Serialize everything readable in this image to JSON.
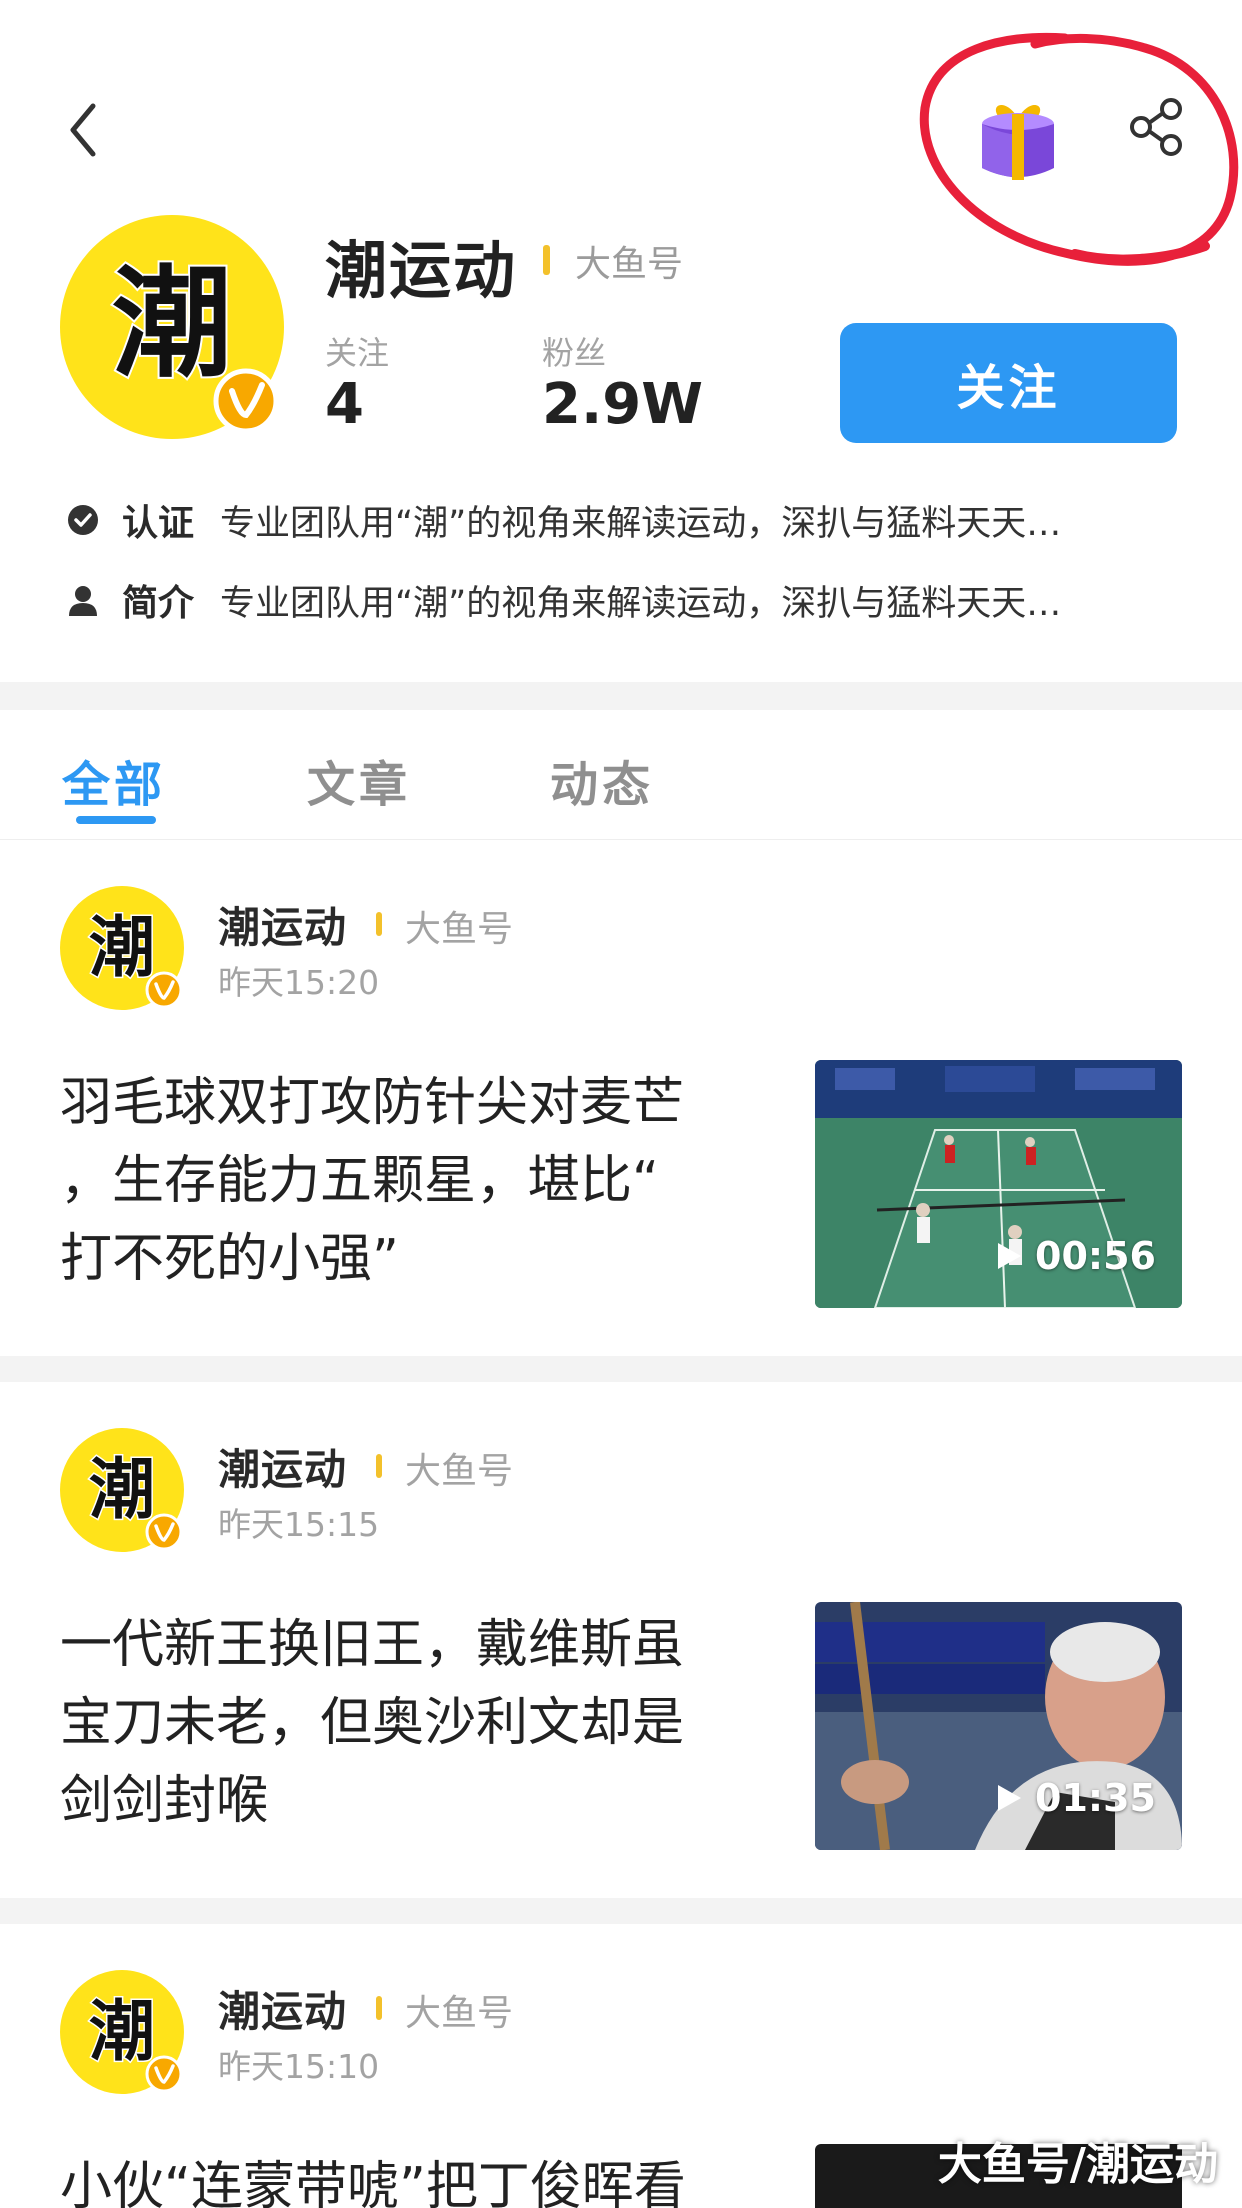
{
  "header": {
    "back_icon": "chevron-left-icon",
    "gift_icon": "gift-box-icon",
    "share_icon": "share-icon"
  },
  "profile": {
    "avatar_text": "潮",
    "name": "潮运动",
    "badge": "大鱼号",
    "following_label": "关注",
    "following_count": "4",
    "fans_label": "粉丝",
    "fans_count": "2.9W",
    "follow_button": "关注",
    "cert_label": "认证",
    "cert_text": "专业团队用“潮”的视角来解读运动，深扒与猛料天天…",
    "intro_label": "简介",
    "intro_text": "专业团队用“潮”的视角来解读运动，深扒与猛料天天…"
  },
  "tabs": [
    {
      "label": "全部",
      "active": true
    },
    {
      "label": "文章",
      "active": false
    },
    {
      "label": "动态",
      "active": false
    }
  ],
  "feed": [
    {
      "author": "潮运动",
      "badge": "大鱼号",
      "time": "昨天15:20",
      "title": "羽毛球双打攻防针尖对麦芒，生存能力五颗星，堪比“打不死的小强”",
      "title_lines": [
        "羽毛球双打攻防针尖对麦芒",
        "，生存能力五颗星，堪比“",
        "打不死的小强”"
      ],
      "duration": "00:56"
    },
    {
      "author": "潮运动",
      "badge": "大鱼号",
      "time": "昨天15:15",
      "title": "一代新王换旧王，戴维斯虽宝刀未老，但奥沙利文却是剑剑封喉",
      "title_lines": [
        "一代新王换旧王，戴维斯虽",
        "宝刀未老，但奥沙利文却是",
        "剑剑封喉"
      ],
      "duration": "01:35"
    },
    {
      "author": "潮运动",
      "badge": "大鱼号",
      "time": "昨天15:10",
      "title_lines": [
        "小伙“连蒙带唬”把丁俊晖看"
      ]
    }
  ],
  "watermark": "大鱼号/潮运动",
  "colors": {
    "accent": "#2d98f3",
    "badge_bar": "#f3c12b",
    "avatar_bg": "#ffe31a",
    "annotation_red": "#e8203a"
  }
}
